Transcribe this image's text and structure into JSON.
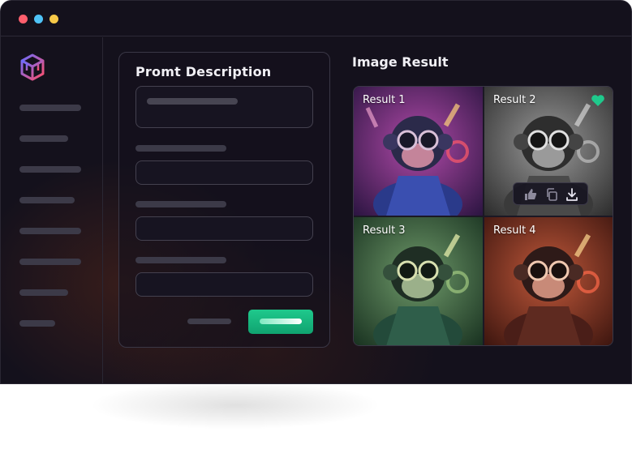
{
  "window": {
    "traffic_lights": [
      {
        "name": "close",
        "color": "#ff5f6d"
      },
      {
        "name": "minimize",
        "color": "#4fc3f7"
      },
      {
        "name": "maximize",
        "color": "#f7c948"
      }
    ]
  },
  "sidebar": {
    "logo_icon": "cube-logo-icon",
    "items": [
      "",
      "",
      "",
      "",
      "",
      "",
      "",
      ""
    ]
  },
  "prompt_panel": {
    "title": "Promt Description"
  },
  "results": {
    "title": "Image Result",
    "items": [
      {
        "label": "Result 1",
        "tint": "#7a3a9a",
        "favorited": false
      },
      {
        "label": "Result 2",
        "tint": "#8a8a8a",
        "favorited": true
      },
      {
        "label": "Result 3",
        "tint": "#3f7a5a",
        "favorited": false
      },
      {
        "label": "Result 4",
        "tint": "#a8452a",
        "favorited": false
      }
    ],
    "actions": [
      "thumbs-up-icon",
      "copy-icon",
      "download-icon"
    ]
  },
  "colors": {
    "accent": "#1fc98c",
    "background": "#14111c"
  }
}
